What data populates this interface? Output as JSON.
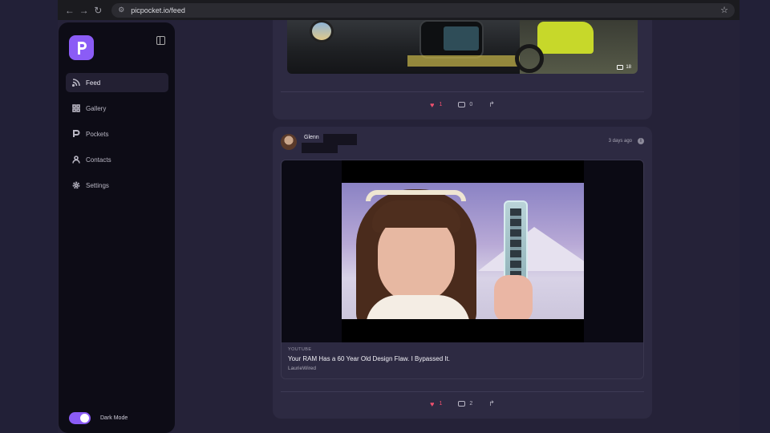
{
  "browser": {
    "url": "picpocket.io/feed",
    "icons": [
      "back-icon",
      "forward-icon",
      "reload-icon",
      "site-settings-icon",
      "bookmark-star-icon"
    ]
  },
  "sidebar": {
    "logo_letter": "P",
    "items": [
      {
        "label": "Feed",
        "icon": "rss-icon",
        "active": true
      },
      {
        "label": "Gallery",
        "icon": "grid-icon",
        "active": false
      },
      {
        "label": "Pockets",
        "icon": "pockets-icon",
        "active": false
      },
      {
        "label": "Contacts",
        "icon": "user-icon",
        "active": false
      },
      {
        "label": "Settings",
        "icon": "gear-icon",
        "active": false
      }
    ],
    "dark_mode_label": "Dark Mode",
    "dark_mode_on": true
  },
  "posts": [
    {
      "photo_count": "18",
      "likes": "1",
      "comments": "0"
    },
    {
      "author": "Glenn",
      "time": "3 days ago",
      "embed": {
        "source": "YOUTUBE",
        "title": "Your RAM Has a 60 Year Old Design Flaw. I Bypassed It.",
        "channel": "LaurieWired"
      },
      "likes": "1",
      "comments": "2"
    }
  ],
  "colors": {
    "accent": "#8b5cf6",
    "like": "#f0506e",
    "background": "#252238",
    "card": "#2d2a42",
    "sidebar": "#0d0c16"
  }
}
